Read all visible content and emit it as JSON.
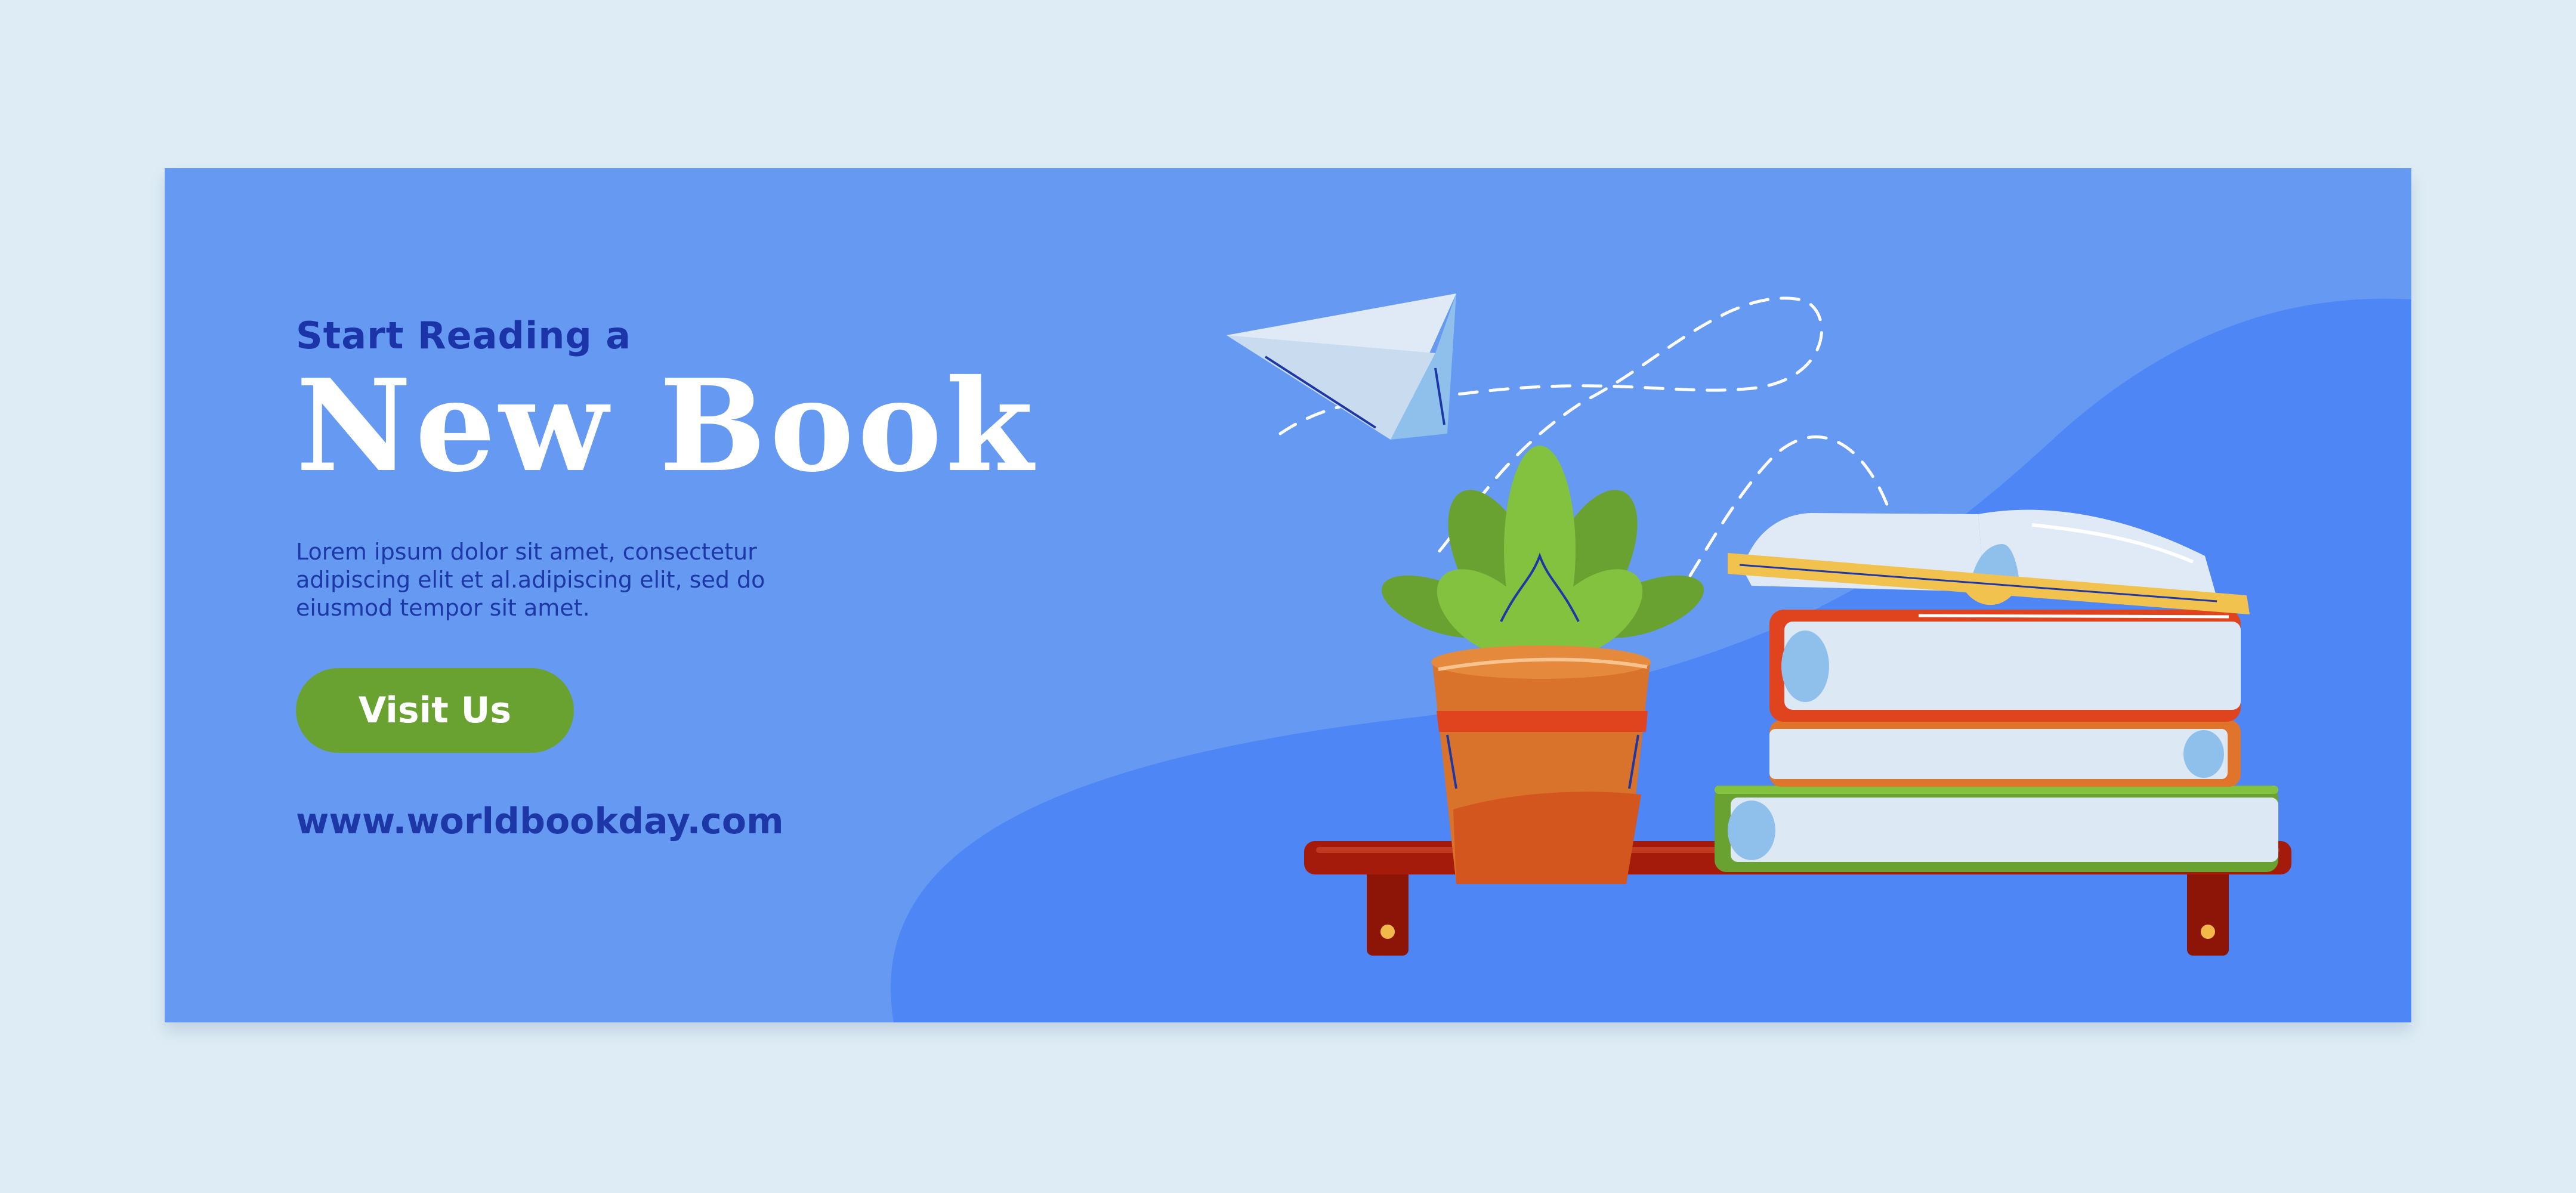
{
  "banner": {
    "subtitle": "Start Reading a",
    "title": "New Book",
    "body": "Lorem ipsum dolor sit amet, consectetur adipiscing elit et al.adipiscing elit, sed do eiusmod tempor sit amet.",
    "cta_label": "Visit Us",
    "url": "www.worldbookday.com"
  },
  "colors": {
    "page_background": "#deedf5",
    "banner_background": "#6699f2",
    "wave": "#4e86f6",
    "accent_dark_blue": "#1d38a6",
    "button_green": "#6aa232",
    "shelf": "#a51b0b",
    "pot": "#d9722a",
    "book_red": "#e0441f",
    "book_orange": "#e0742a",
    "book_green": "#6aa232",
    "page_paper": "#dce8f3"
  },
  "icons": [
    "paper-plane-icon",
    "potted-plant-icon",
    "book-stack-icon",
    "open-book-icon",
    "wall-shelf-icon"
  ]
}
